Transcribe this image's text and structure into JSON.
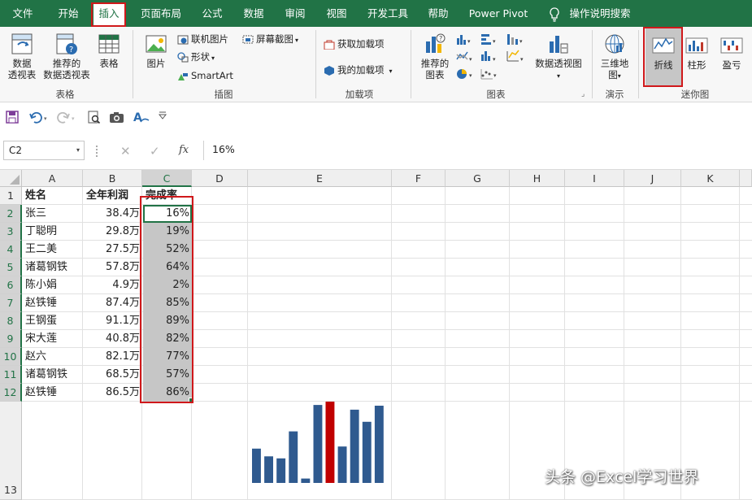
{
  "ribbon_tabs": [
    "文件",
    "开始",
    "插入",
    "页面布局",
    "公式",
    "数据",
    "审阅",
    "视图",
    "开发工具",
    "帮助",
    "Power Pivot",
    "操作说明搜索"
  ],
  "ribbon": {
    "pivot_table": "数据\n透视表",
    "recommended_pivot": "推荐的\n数据透视表",
    "table": "表格",
    "group_tables": "表格",
    "pictures": "图片",
    "online_pictures": "联机图片",
    "shapes": "形状",
    "smartart": "SmartArt",
    "screenshot": "屏幕截图",
    "group_illustrations": "插图",
    "get_addins": "获取加载项",
    "my_addins": "我的加载项",
    "group_addins": "加载项",
    "recommended_charts": "推荐的\n图表",
    "pivot_chart": "数据透视图",
    "group_charts": "图表",
    "map_3d": "三维地\n图",
    "group_tours": "演示",
    "spark_line": "折线",
    "spark_column": "柱形",
    "spark_winloss": "盈亏",
    "group_sparklines": "迷你图"
  },
  "formula_bar": {
    "name_box": "C2",
    "fx": "fx",
    "value": "16%"
  },
  "columns": [
    "A",
    "B",
    "C",
    "D",
    "E",
    "F",
    "G",
    "H",
    "I",
    "J",
    "K"
  ],
  "row_numbers": [
    "1",
    "2",
    "3",
    "4",
    "5",
    "6",
    "7",
    "8",
    "9",
    "10",
    "11",
    "12",
    "13"
  ],
  "table": {
    "headers": [
      "姓名",
      "全年利润",
      "完成率"
    ],
    "rows": [
      [
        "张三",
        "38.4万",
        "16%"
      ],
      [
        "丁聪明",
        "29.8万",
        "19%"
      ],
      [
        "王二美",
        "27.5万",
        "52%"
      ],
      [
        "诸葛钢铁",
        "57.8万",
        "64%"
      ],
      [
        "陈小娟",
        "4.9万",
        "2%"
      ],
      [
        "赵铁锤",
        "87.4万",
        "85%"
      ],
      [
        "王钢蛋",
        "91.1万",
        "89%"
      ],
      [
        "宋大莲",
        "40.8万",
        "82%"
      ],
      [
        "赵六",
        "82.1万",
        "77%"
      ],
      [
        "诸葛钢铁",
        "68.5万",
        "57%"
      ],
      [
        "赵铁锤",
        "86.5万",
        "86%"
      ]
    ]
  },
  "chart_data": {
    "type": "bar",
    "categories": [
      "张三",
      "丁聪明",
      "王二美",
      "诸葛钢铁",
      "陈小娟",
      "赵铁锤",
      "王钢蛋",
      "宋大莲",
      "赵六",
      "诸葛钢铁",
      "赵铁锤"
    ],
    "values": [
      38.4,
      29.8,
      27.5,
      57.8,
      4.9,
      87.4,
      91.1,
      40.8,
      82.1,
      68.5,
      86.5
    ],
    "highlight_max": true,
    "bar_color": "#2f5a8f",
    "highlight_color": "#c00000",
    "ylim": [
      0,
      91.1
    ]
  },
  "colors": {
    "accent": "#217346",
    "highlight": "#d0181b"
  },
  "watermark": "头条 @Excel学习世界"
}
